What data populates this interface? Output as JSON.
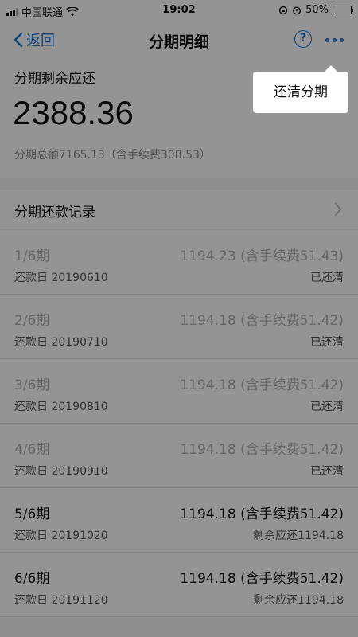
{
  "status_bar": {
    "carrier": "中国联通",
    "time": "19:02",
    "battery": "50%",
    "battery_level": 0.5
  },
  "nav": {
    "back_label": "返回",
    "title": "分期明细",
    "help_glyph": "?"
  },
  "summary": {
    "remaining_label": "分期剩余应还",
    "remaining_amount": "2388.36",
    "total_text": "分期总额7165.13（含手续费308.53）"
  },
  "records": {
    "title": "分期还款记录",
    "items": [
      {
        "period": "1/6期",
        "amount": "1194.23 (含手续费51.43)",
        "date": "还款日 20190610",
        "status": "已还清"
      },
      {
        "period": "2/6期",
        "amount": "1194.18 (含手续费51.42)",
        "date": "还款日 20190710",
        "status": "已还清"
      },
      {
        "period": "3/6期",
        "amount": "1194.18 (含手续费51.42)",
        "date": "还款日 20190810",
        "status": "已还清"
      },
      {
        "period": "4/6期",
        "amount": "1194.18 (含手续费51.42)",
        "date": "还款日 20190910",
        "status": "已还清"
      },
      {
        "period": "5/6期",
        "amount": "1194.18 (含手续费51.42)",
        "date": "还款日 20191020",
        "status": "剩余应还1194.18"
      },
      {
        "period": "6/6期",
        "amount": "1194.18 (含手续费51.42)",
        "date": "还款日 20191120",
        "status": "剩余应还1194.18"
      }
    ]
  },
  "popover": {
    "item_label": "还清分期"
  },
  "colors": {
    "accent": "#1a73d9",
    "overlay": "rgba(0,0,0,0.42)"
  }
}
